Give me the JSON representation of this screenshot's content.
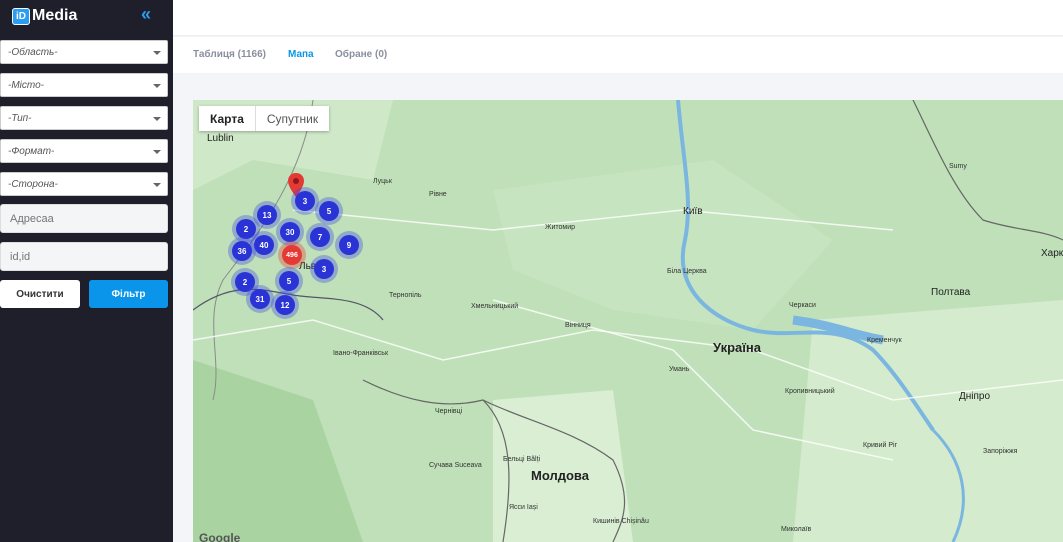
{
  "app": {
    "logo_box": "iD",
    "logo_text": "Media",
    "collapse_icon": "«"
  },
  "filters": {
    "region": "-Область-",
    "city": "-Місто-",
    "type": "-Тип-",
    "format": "-Формат-",
    "side": "-Сторона-",
    "address_placeholder": "Адресаа",
    "id_placeholder": "id,id",
    "clear_label": "Очистити",
    "filter_label": "Фільтр"
  },
  "tabs": [
    {
      "label": "Таблиця (1166)"
    },
    {
      "label": "Мапа"
    },
    {
      "label": "Обране (0)"
    }
  ],
  "map": {
    "toggle_map": "Карта",
    "toggle_satellite": "Супутник",
    "attribution": "Google",
    "labels": {
      "ukraine": "Україна",
      "moldova": "Молдова",
      "kyiv": "Київ",
      "lviv": "Льв",
      "lutsk": "Луцьк",
      "rivne": "Рівне",
      "zhytomyr": "Житомир",
      "ternopil": "Тернопіль",
      "khmelnytskyi": "Хмельницький",
      "vinnytsia": "Вінниця",
      "ivano_frankivsk": "Івано-Франківськ",
      "chernivtsi": "Чернівці",
      "cherkasy": "Черкаси",
      "poltava": "Полтава",
      "dnipro": "Дніпро",
      "kryvyi_rih": "Кривий Ріг",
      "kropyvnytskyi": "Кропивницький",
      "kremenchuk": "Кременчук",
      "zaporizhzhia": "Запоріжжя",
      "mykolaiv": "Миколаїв",
      "chisinau": "Кишинів Chișinău",
      "balti": "Бельці Bălți",
      "iasi": "Ясси Iași",
      "suceava": "Сучава Suceava",
      "sumy": "Sumy",
      "lublin": "Lublin",
      "uman": "Умань",
      "bila_tserkva": "Біла Церква",
      "khark": "Харк"
    },
    "clusters": [
      {
        "value": "3"
      },
      {
        "value": "5"
      },
      {
        "value": "13"
      },
      {
        "value": "2"
      },
      {
        "value": "30"
      },
      {
        "value": "7"
      },
      {
        "value": "9"
      },
      {
        "value": "40"
      },
      {
        "value": "36"
      },
      {
        "value": "496"
      },
      {
        "value": "3"
      },
      {
        "value": "2"
      },
      {
        "value": "5"
      },
      {
        "value": "31"
      },
      {
        "value": "12"
      }
    ]
  },
  "colors": {
    "accent": "#0a95ea",
    "sidebar": "#1e1f2b",
    "cluster": "#2a33d6",
    "cluster_hot": "#e53935"
  }
}
